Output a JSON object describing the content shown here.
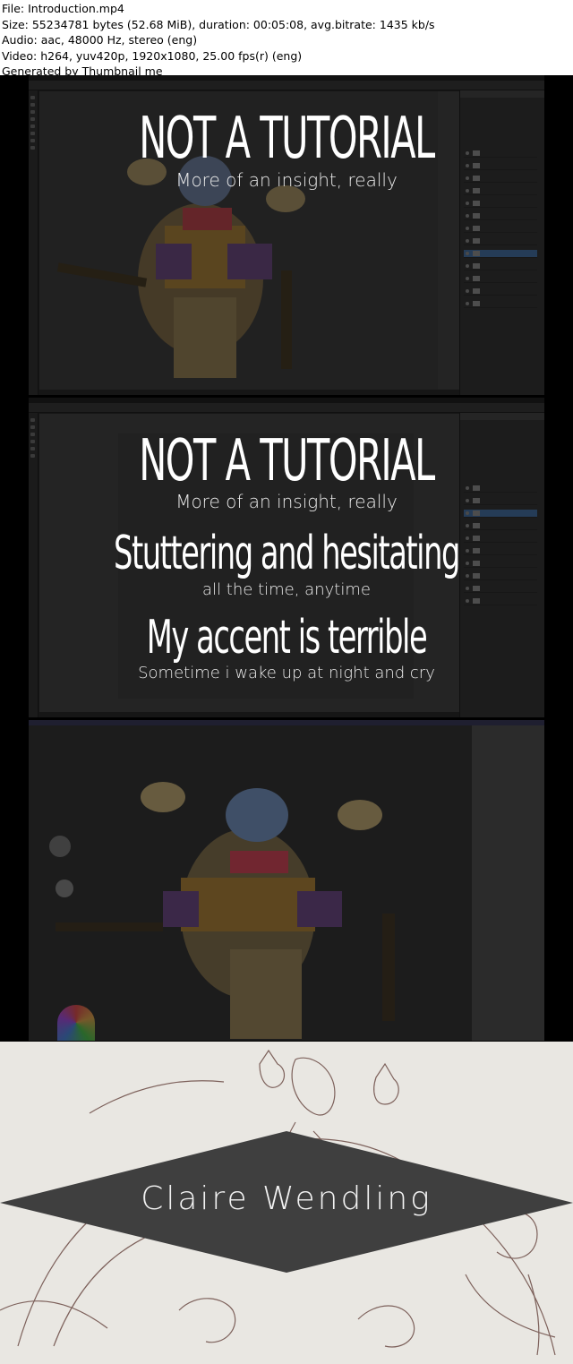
{
  "header": {
    "file": "File: Introduction.mp4",
    "size": "Size: 55234781 bytes (52.68 MiB), duration: 00:05:08, avg.bitrate: 1435 kb/s",
    "audio": "Audio: aac, 48000 Hz, stereo (eng)",
    "video": "Video: h264, yuv420p, 1920x1080, 25.00 fps(r) (eng)",
    "generated": "Generated by Thumbnail me"
  },
  "frame1": {
    "title": "NOT A TUTORIAL",
    "subtitle": "More of an insight, really"
  },
  "frame2": {
    "title1": "NOT A TUTORIAL",
    "subtitle1": "More of an insight, really",
    "title2": "Stuttering and hesitating",
    "subtitle2": "all the time, anytime",
    "title3": "My accent is terrible",
    "subtitle3": "Sometime i wake up at night and cry"
  },
  "frame4": {
    "name": "Claire Wendling"
  },
  "colors": {
    "layer_selected": "#3a5d86",
    "banner": "#3f3f3f",
    "paper": "#e9e7e2",
    "sketch": "#6b4a44"
  }
}
